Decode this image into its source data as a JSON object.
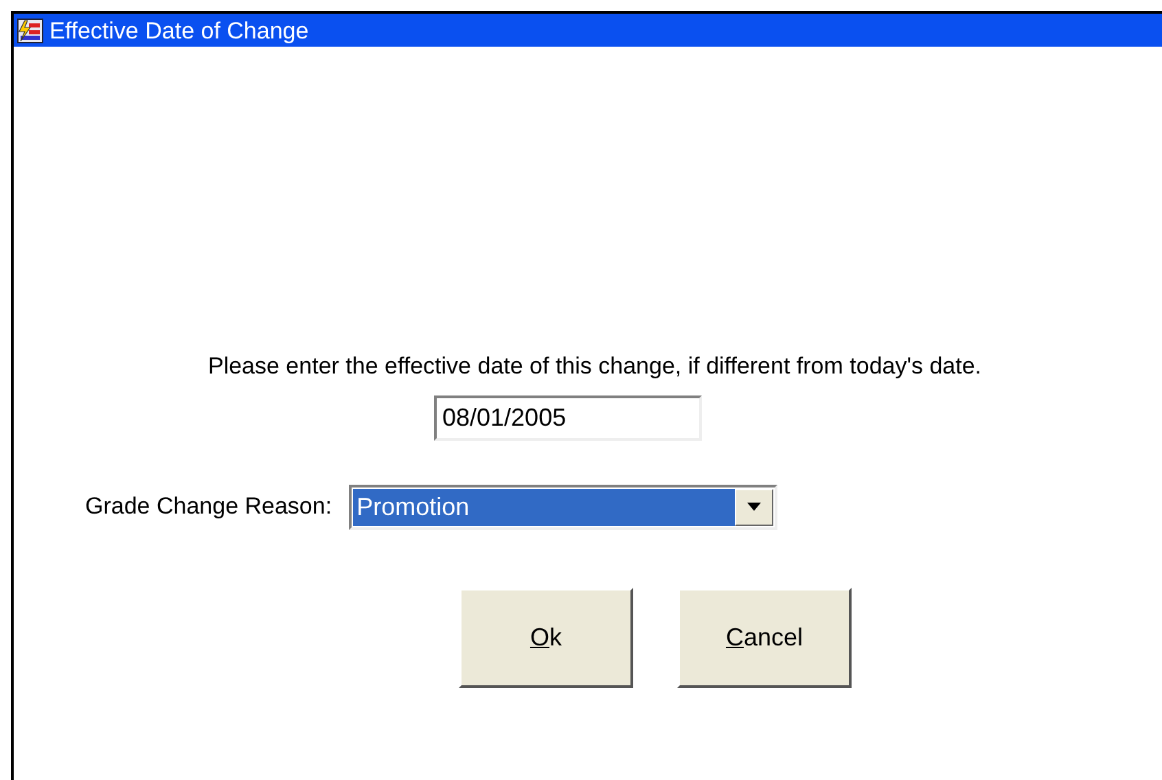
{
  "window": {
    "title": "Effective Date of Change"
  },
  "prompt": "Please enter the effective date of this change, if different from today's date.",
  "date_field": {
    "value": "08/01/2005"
  },
  "reason": {
    "label": "Grade Change Reason:",
    "value": "Promotion",
    "selected": true
  },
  "buttons": [
    {
      "label": "Ok"
    },
    {
      "label": "Cancel"
    }
  ]
}
